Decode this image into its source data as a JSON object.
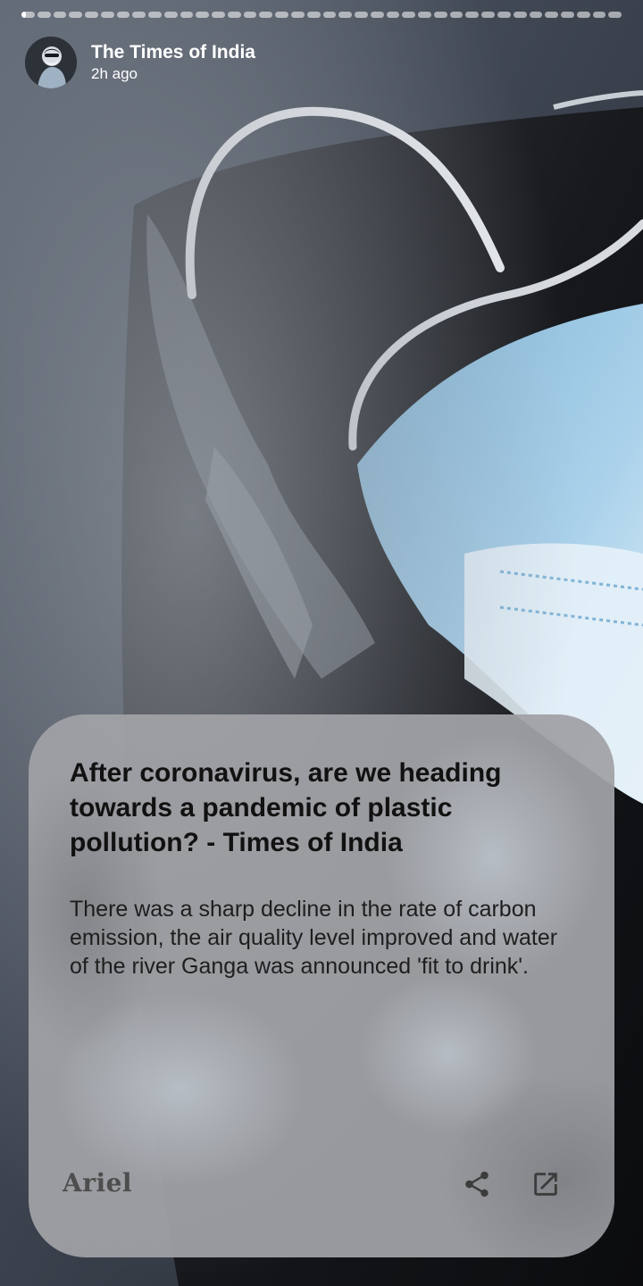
{
  "story": {
    "total_segments": 38,
    "current_segment": 1,
    "current_progress": 0.35
  },
  "publisher": {
    "name": "The Times of India",
    "time": "2h ago"
  },
  "article": {
    "headline": "After coronavirus, are we heading towards a pandemic of plastic pollution? - Times of India",
    "summary": "There was a sharp decline in the rate of carbon emission, the air quality level improved and water of the river Ganga was announced 'fit to drink'."
  },
  "footer": {
    "brand": "Ariel",
    "share_icon": "share-icon",
    "open_icon": "open-in-new-icon"
  },
  "colors": {
    "card_background": "#a0a2a6",
    "headline_text": "#111111",
    "brand_text": "#4d4d4d",
    "icon": "#3c3c3c"
  }
}
